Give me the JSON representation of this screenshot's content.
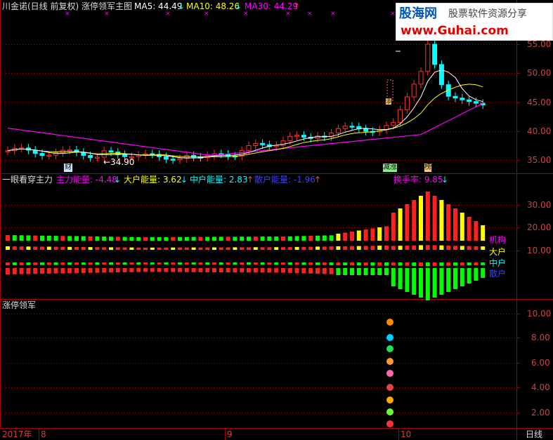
{
  "panel1": {
    "title": "川金诺(日线 前复权) 涨停领军主图",
    "ma5": "MA5: 44.49",
    "ma10": "MA10: 48.26",
    "ma30": "MA30: 44.29",
    "low_label": "←34.90",
    "marker_cai": "财",
    "marker_jianzhang": "减涨",
    "marker_bang": "榜",
    "marker_tian": "添",
    "colors": {
      "ma5": "#ffffff",
      "ma10": "#ffff00",
      "ma30": "#ff00ff",
      "up": "#ff3232",
      "down": "#00ffff"
    }
  },
  "panel2": {
    "title": "一眼看穿主力",
    "zhuli": "主力能量: -4.48",
    "dahu": "大户能量: 3.62",
    "zhonghu": "中户能量: 2.83",
    "sanhu": "散户能量: -1.96",
    "huanshou": "换手率: 9.85",
    "label_jigou": "机构",
    "label_dahu": "大户",
    "label_zhonghu": "中户",
    "label_sanhu": "散户"
  },
  "panel3": {
    "title": "涨停领军"
  },
  "axis1": [
    "55.00",
    "50.00",
    "45.00",
    "40.00",
    "35.00"
  ],
  "axis2": [
    "30.00",
    "20.00",
    "10.00"
  ],
  "axis3": [
    "10.00",
    "8.00",
    "6.00",
    "4.00",
    "2.00"
  ],
  "xaxis": {
    "year": "2017年",
    "m8": "8",
    "m9": "9",
    "m10": "10",
    "period": "日线"
  },
  "logo": {
    "name": "股海网",
    "slogan": "股票软件资源分享",
    "url": "www.Guhai.com"
  }
}
